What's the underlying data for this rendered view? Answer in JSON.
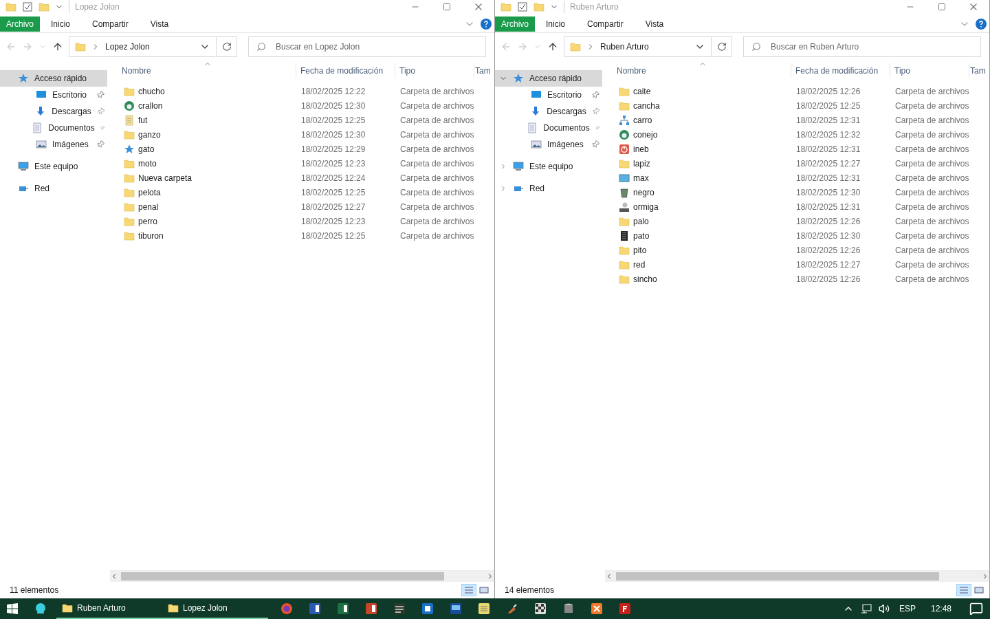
{
  "windows": [
    {
      "title": "Lopez Jolon",
      "ribbon_tabs": [
        {
          "label": "Archivo",
          "kind": "file"
        },
        {
          "label": "Inicio",
          "kind": "tab"
        },
        {
          "label": "Compartir",
          "kind": "tab"
        },
        {
          "label": "Vista",
          "kind": "tab"
        }
      ],
      "address": "Lopez Jolon",
      "search": {
        "placeholder": "Buscar en Lopez Jolon"
      },
      "nav": [
        {
          "label": "Acceso rápido",
          "kind": "star",
          "selected": true,
          "pinned": false
        },
        {
          "label": "Escritorio",
          "kind": "desktop",
          "selected": false,
          "pinned": true
        },
        {
          "label": "Descargas",
          "kind": "download",
          "selected": false,
          "pinned": true
        },
        {
          "label": "Documentos",
          "kind": "docs",
          "selected": false,
          "pinned": true
        },
        {
          "label": "Imágenes",
          "kind": "images",
          "selected": false,
          "pinned": true
        },
        {
          "label": "Este equipo",
          "kind": "pc",
          "selected": false,
          "pinned": false
        },
        {
          "label": "Red",
          "kind": "network",
          "selected": false,
          "pinned": false
        }
      ],
      "columns": [
        "Nombre",
        "Fecha de modificación",
        "Tipo",
        "Tam"
      ],
      "rows": [
        {
          "name": "chucho",
          "kind": "folder",
          "date": "18/02/2025 12:22",
          "type": "Carpeta de archivos"
        },
        {
          "name": "crallon",
          "kind": "globe",
          "date": "18/02/2025 12:30",
          "type": "Carpeta de archivos"
        },
        {
          "name": "fut",
          "kind": "doc",
          "date": "18/02/2025 12:25",
          "type": "Carpeta de archivos"
        },
        {
          "name": "ganzo",
          "kind": "folder",
          "date": "18/02/2025 12:30",
          "type": "Carpeta de archivos"
        },
        {
          "name": "gato",
          "kind": "star",
          "date": "18/02/2025 12:29",
          "type": "Carpeta de archivos"
        },
        {
          "name": "moto",
          "kind": "folder",
          "date": "18/02/2025 12:23",
          "type": "Carpeta de archivos"
        },
        {
          "name": "Nueva carpeta",
          "kind": "folder",
          "date": "18/02/2025 12:24",
          "type": "Carpeta de archivos"
        },
        {
          "name": "pelota",
          "kind": "folder",
          "date": "18/02/2025 12:25",
          "type": "Carpeta de archivos"
        },
        {
          "name": "penal",
          "kind": "folder",
          "date": "18/02/2025 12:27",
          "type": "Carpeta de archivos"
        },
        {
          "name": "perro",
          "kind": "folder",
          "date": "18/02/2025 12:23",
          "type": "Carpeta de archivos"
        },
        {
          "name": "tiburon",
          "kind": "folder",
          "date": "18/02/2025 12:25",
          "type": "Carpeta de archivos"
        }
      ],
      "status": "11 elementos"
    },
    {
      "title": "Ruben Arturo",
      "ribbon_tabs": [
        {
          "label": "Archivo",
          "kind": "file"
        },
        {
          "label": "Inicio",
          "kind": "tab"
        },
        {
          "label": "Compartir",
          "kind": "tab"
        },
        {
          "label": "Vista",
          "kind": "tab"
        }
      ],
      "address": "Ruben Arturo",
      "search": {
        "placeholder": "Buscar en Ruben Arturo"
      },
      "nav": [
        {
          "label": "Acceso rápido",
          "kind": "star",
          "selected": true,
          "pinned": false,
          "expanded": true
        },
        {
          "label": "Escritorio",
          "kind": "desktop",
          "selected": false,
          "pinned": true
        },
        {
          "label": "Descargas",
          "kind": "download",
          "selected": false,
          "pinned": true
        },
        {
          "label": "Documentos",
          "kind": "docs",
          "selected": false,
          "pinned": true
        },
        {
          "label": "Imágenes",
          "kind": "images",
          "selected": false,
          "pinned": true
        },
        {
          "label": "Este equipo",
          "kind": "pc",
          "selected": false,
          "pinned": false,
          "expanded": false
        },
        {
          "label": "Red",
          "kind": "network",
          "selected": false,
          "pinned": false,
          "expanded": false
        }
      ],
      "columns": [
        "Nombre",
        "Fecha de modificación",
        "Tipo",
        "Tam"
      ],
      "rows": [
        {
          "name": "caite",
          "kind": "folder",
          "date": "18/02/2025 12:26",
          "type": "Carpeta de archivos"
        },
        {
          "name": "cancha",
          "kind": "folder",
          "date": "18/02/2025 12:25",
          "type": "Carpeta de archivos"
        },
        {
          "name": "carro",
          "kind": "network",
          "date": "18/02/2025 12:31",
          "type": "Carpeta de archivos"
        },
        {
          "name": "conejo",
          "kind": "globe",
          "date": "18/02/2025 12:32",
          "type": "Carpeta de archivos"
        },
        {
          "name": "ineb",
          "kind": "power",
          "date": "18/02/2025 12:31",
          "type": "Carpeta de archivos"
        },
        {
          "name": "lapiz",
          "kind": "folder",
          "date": "18/02/2025 12:27",
          "type": "Carpeta de archivos"
        },
        {
          "name": "max",
          "kind": "monitor",
          "date": "18/02/2025 12:31",
          "type": "Carpeta de archivos"
        },
        {
          "name": "negro",
          "kind": "recycle",
          "date": "18/02/2025 12:30",
          "type": "Carpeta de archivos"
        },
        {
          "name": "ormiga",
          "kind": "drive",
          "date": "18/02/2025 12:31",
          "type": "Carpeta de archivos"
        },
        {
          "name": "palo",
          "kind": "folder",
          "date": "18/02/2025 12:26",
          "type": "Carpeta de archivos"
        },
        {
          "name": "pato",
          "kind": "film",
          "date": "18/02/2025 12:30",
          "type": "Carpeta de archivos"
        },
        {
          "name": "pito",
          "kind": "folder",
          "date": "18/02/2025 12:26",
          "type": "Carpeta de archivos"
        },
        {
          "name": "red",
          "kind": "folder",
          "date": "18/02/2025 12:27",
          "type": "Carpeta de archivos"
        },
        {
          "name": "sincho",
          "kind": "folder",
          "date": "18/02/2025 12:26",
          "type": "Carpeta de archivos"
        }
      ],
      "status": "14 elementos"
    }
  ],
  "taskbar": {
    "windows": [
      {
        "label": "Ruben Arturo"
      },
      {
        "label": "Lopez Jolon"
      }
    ],
    "apps": [
      {
        "kind": "firefox"
      },
      {
        "kind": "word"
      },
      {
        "kind": "excel"
      },
      {
        "kind": "powerpoint"
      },
      {
        "kind": "tool"
      },
      {
        "kind": "outlook"
      },
      {
        "kind": "monitor"
      },
      {
        "kind": "notes"
      },
      {
        "kind": "brush"
      },
      {
        "kind": "grid"
      },
      {
        "kind": "db"
      },
      {
        "kind": "xampp"
      },
      {
        "kind": "flash"
      }
    ],
    "language": "ESP",
    "time": "12:48"
  }
}
